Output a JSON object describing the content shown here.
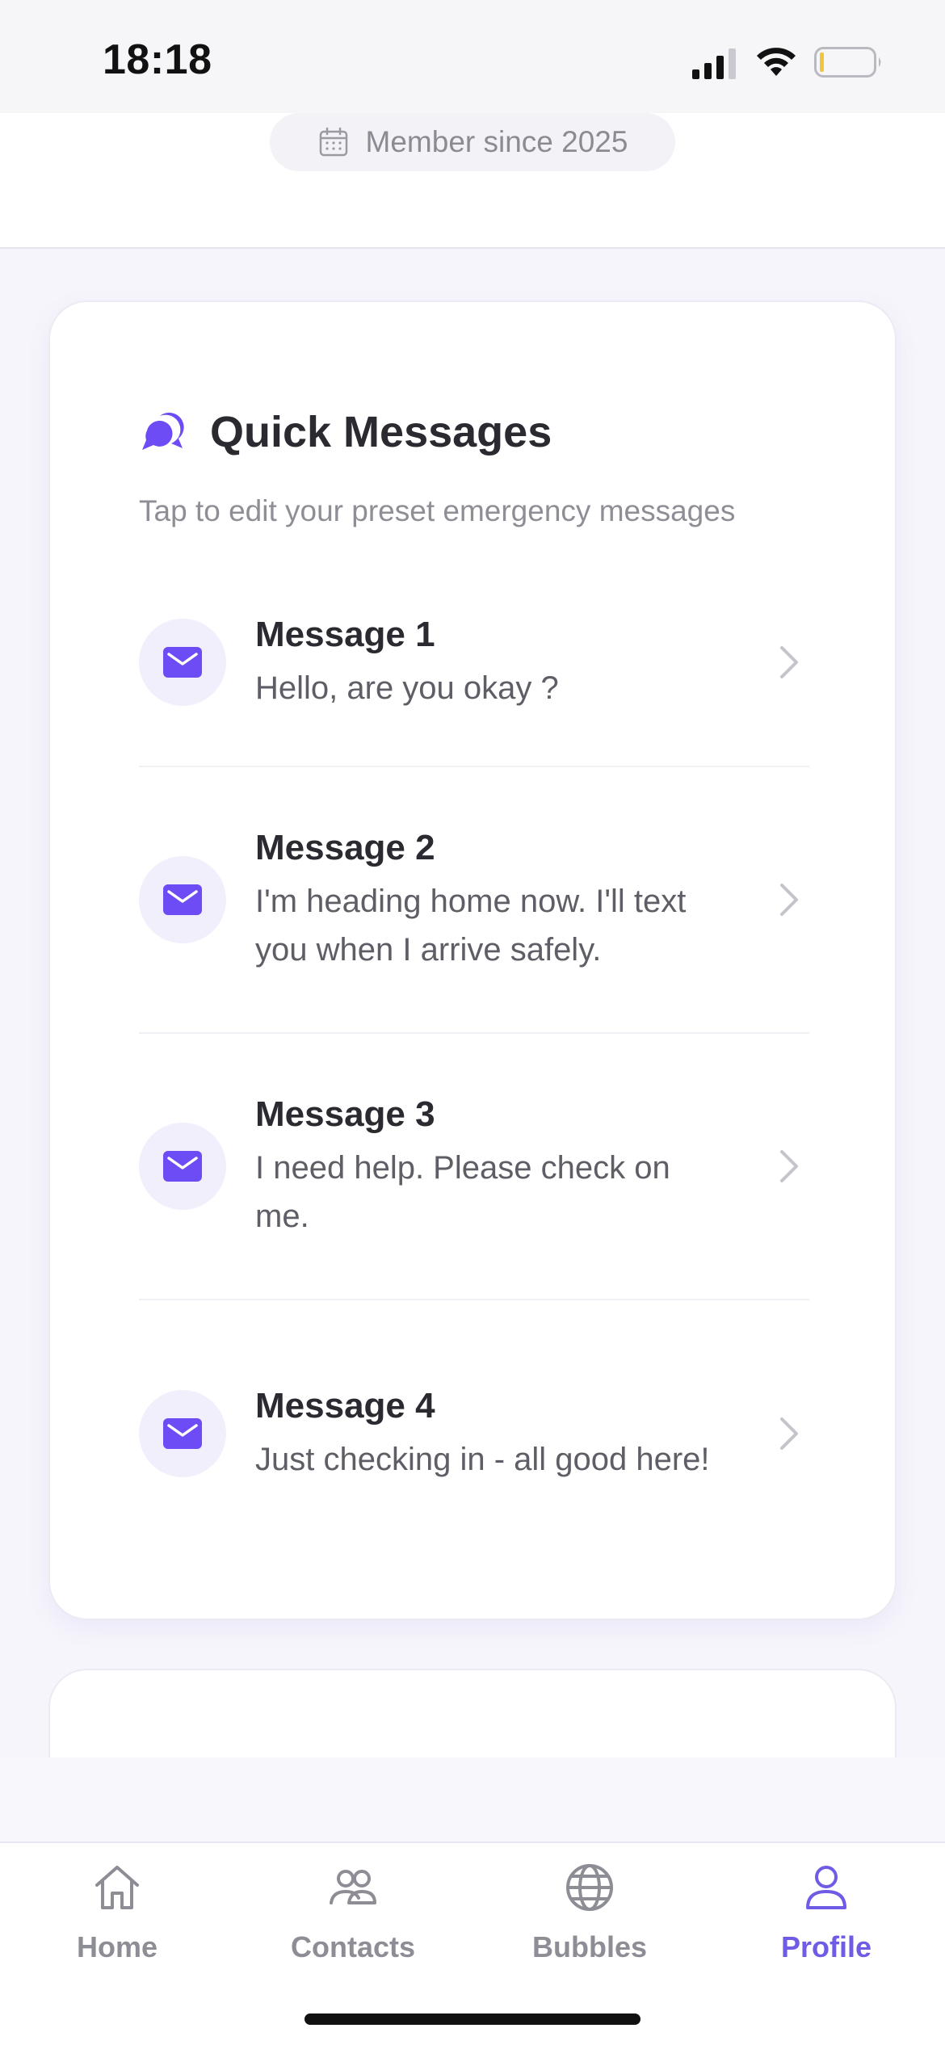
{
  "status_bar": {
    "time": "18:18",
    "icons": [
      "cellular-signal-icon",
      "wifi-icon",
      "battery-icon"
    ]
  },
  "profile_header": {
    "member_since": "Member since 2025",
    "icon": "calendar-icon"
  },
  "quick_messages": {
    "title": "Quick Messages",
    "subtitle": "Tap to edit your preset emergency messages",
    "icon": "chat-bubbles-icon",
    "accent_color": "#6E4CF5",
    "messages": [
      {
        "title": "Message 1",
        "body": "Hello, are you okay ?"
      },
      {
        "title": "Message 2",
        "body": "I'm heading home now. I'll text you when I arrive safely."
      },
      {
        "title": "Message 3",
        "body": "I need help. Please check on me."
      },
      {
        "title": "Message 4",
        "body": "Just checking in - all good here!"
      }
    ]
  },
  "tab_bar": {
    "active_color": "#6E5CE6",
    "inactive_color": "#8D8D95",
    "tabs": [
      {
        "label": "Home",
        "icon": "home-icon",
        "active": false
      },
      {
        "label": "Contacts",
        "icon": "contacts-icon",
        "active": false
      },
      {
        "label": "Bubbles",
        "icon": "globe-icon",
        "active": false
      },
      {
        "label": "Profile",
        "icon": "person-icon",
        "active": true
      }
    ]
  }
}
